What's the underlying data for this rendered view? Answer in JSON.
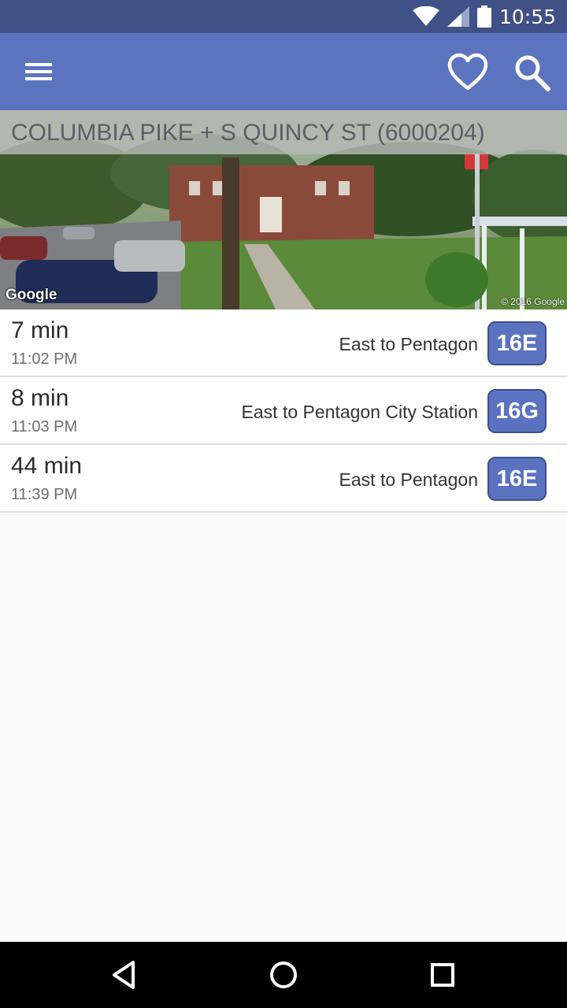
{
  "status_bar": {
    "time": "10:55",
    "icons": [
      "wifi-icon",
      "cell-signal-icon",
      "battery-icon"
    ]
  },
  "app_bar": {
    "actions": [
      "menu-icon",
      "favorite-heart-icon",
      "search-icon"
    ],
    "color": "#5c74c0"
  },
  "stop": {
    "title": "COLUMBIA PIKE + S QUINCY ST (6000204)",
    "image_watermark": "Google",
    "image_copyright": "© 2016 Google"
  },
  "arrivals": [
    {
      "minutes": "7 min",
      "time": "11:02 PM",
      "destination": "East to Pentagon",
      "route": "16E"
    },
    {
      "minutes": "8 min",
      "time": "11:03 PM",
      "destination": "East to Pentagon City Station",
      "route": "16G"
    },
    {
      "minutes": "44 min",
      "time": "11:39 PM",
      "destination": "East to Pentagon",
      "route": "16E"
    }
  ],
  "nav_bar": {
    "buttons": [
      "back-icon",
      "home-icon",
      "recents-icon"
    ]
  },
  "colors": {
    "status_bar": "#3f5186",
    "route_badge": "#5a72bf",
    "background": "#fafafa"
  }
}
